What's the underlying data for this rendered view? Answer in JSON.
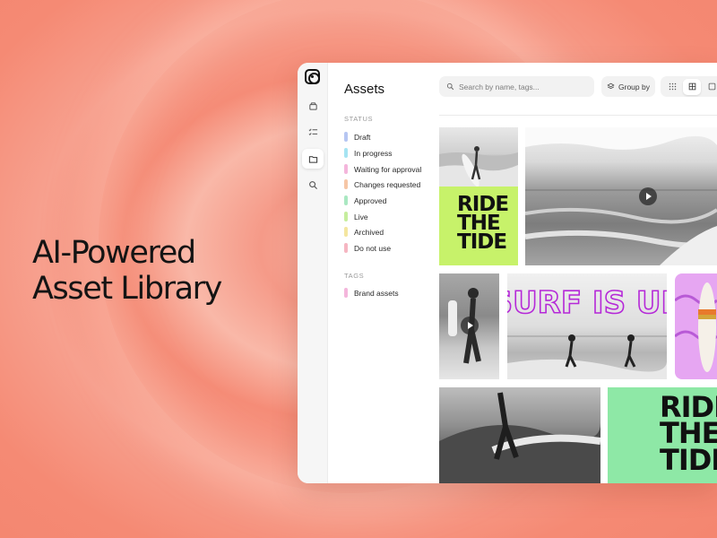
{
  "headline": {
    "line1": "AI-Powered",
    "line2": "Asset Library"
  },
  "app": {
    "rail_icons": [
      "logo-icon",
      "inbox-icon",
      "checklist-icon",
      "folder-icon",
      "search-icon"
    ],
    "sidebar": {
      "title": "Assets",
      "status_label": "STATUS",
      "statuses": [
        {
          "label": "Draft",
          "color": "#b6c6f2"
        },
        {
          "label": "In progress",
          "color": "#a6e4f2"
        },
        {
          "label": "Waiting for approval",
          "color": "#f4b6dc"
        },
        {
          "label": "Changes requested",
          "color": "#f6c6a6"
        },
        {
          "label": "Approved",
          "color": "#aae8c2"
        },
        {
          "label": "Live",
          "color": "#c6ee9e"
        },
        {
          "label": "Archived",
          "color": "#f4e6a0"
        },
        {
          "label": "Do not use",
          "color": "#f6b6c2"
        }
      ],
      "tags_label": "TAGS",
      "tags": [
        {
          "label": "Brand assets",
          "color": "#f4b6dc"
        }
      ]
    },
    "toolbar": {
      "search_placeholder": "Search by name, tags...",
      "group_by_label": "Group by",
      "view_modes": [
        "grid-small",
        "grid-large",
        "single"
      ],
      "active_view": "grid-large"
    },
    "grid": {
      "poster_text_1": [
        "RIDE",
        "THE",
        "TIDE"
      ],
      "poster_text_2": [
        "RIDE",
        "THE",
        "TIDE"
      ],
      "surf_text": "SURF IS UP",
      "poster_green_1": "#c7f26a",
      "poster_green_2": "#8ee8a6",
      "poster_pink": "#e6a6f2"
    }
  }
}
